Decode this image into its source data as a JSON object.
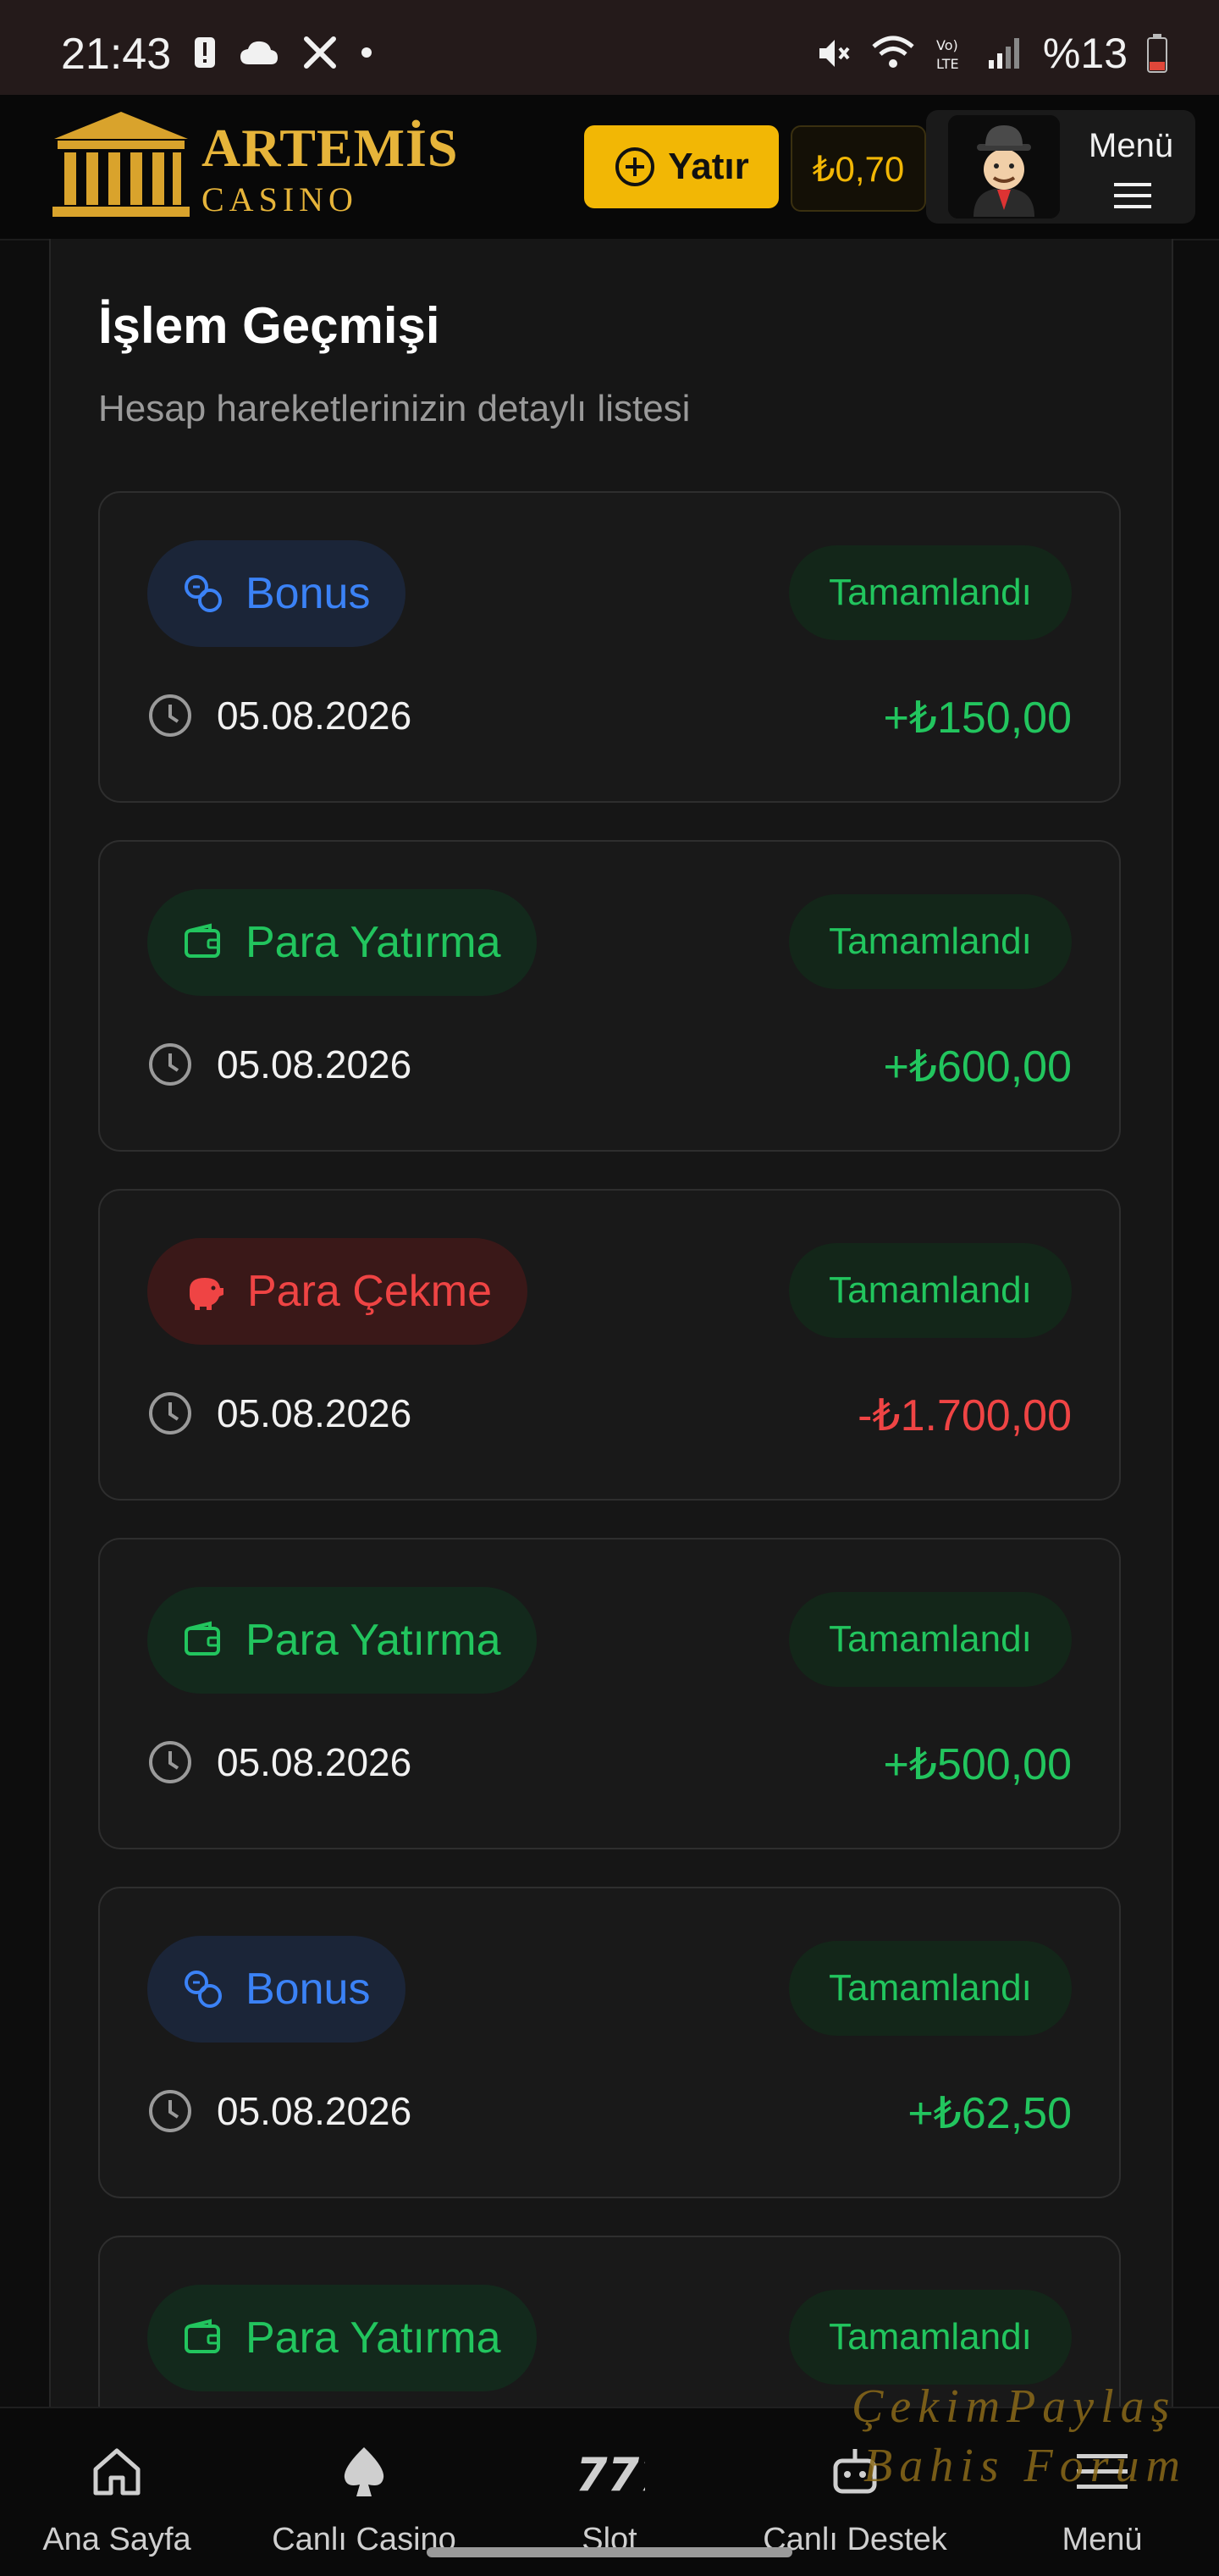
{
  "status_bar": {
    "time": "21:43",
    "battery": "%13"
  },
  "header": {
    "logo_title": "ARTEMİS",
    "logo_sub": "CASINO",
    "deposit_label": "Yatır",
    "balance": "₺0,70",
    "menu_label": "Menü"
  },
  "page": {
    "title": "İşlem Geçmişi",
    "subtitle": "Hesap hareketlerinizin detaylı listesi"
  },
  "transactions": [
    {
      "type": "Bonus",
      "status": "Tamamlandı",
      "date": "05.08.2026",
      "amount": "+₺150,00"
    },
    {
      "type": "Para Yatırma",
      "status": "Tamamlandı",
      "date": "05.08.2026",
      "amount": "+₺600,00"
    },
    {
      "type": "Para Çekme",
      "status": "Tamamlandı",
      "date": "05.08.2026",
      "amount": "-₺1.700,00"
    },
    {
      "type": "Para Yatırma",
      "status": "Tamamlandı",
      "date": "05.08.2026",
      "amount": "+₺500,00"
    },
    {
      "type": "Bonus",
      "status": "Tamamlandı",
      "date": "05.08.2026",
      "amount": "+₺62,50"
    },
    {
      "type": "Para Yatırma",
      "status": "Tamamlandı"
    }
  ],
  "bottom_nav": [
    {
      "label": "Ana Sayfa",
      "icon": "home-icon"
    },
    {
      "label": "Canlı Casino",
      "icon": "spade-icon"
    },
    {
      "label": "Slot",
      "icon": "slot-777-icon"
    },
    {
      "label": "Canlı Destek",
      "icon": "support-robot-icon"
    },
    {
      "label": "Menü",
      "icon": "menu-icon"
    }
  ],
  "watermark": {
    "line1": "ÇekimPaylaş",
    "line2": "Bahis Forum"
  },
  "colors": {
    "accent": "#f2b705",
    "positive": "#22c55e",
    "negative": "#ef4444",
    "bonus": "#3b82f6"
  }
}
